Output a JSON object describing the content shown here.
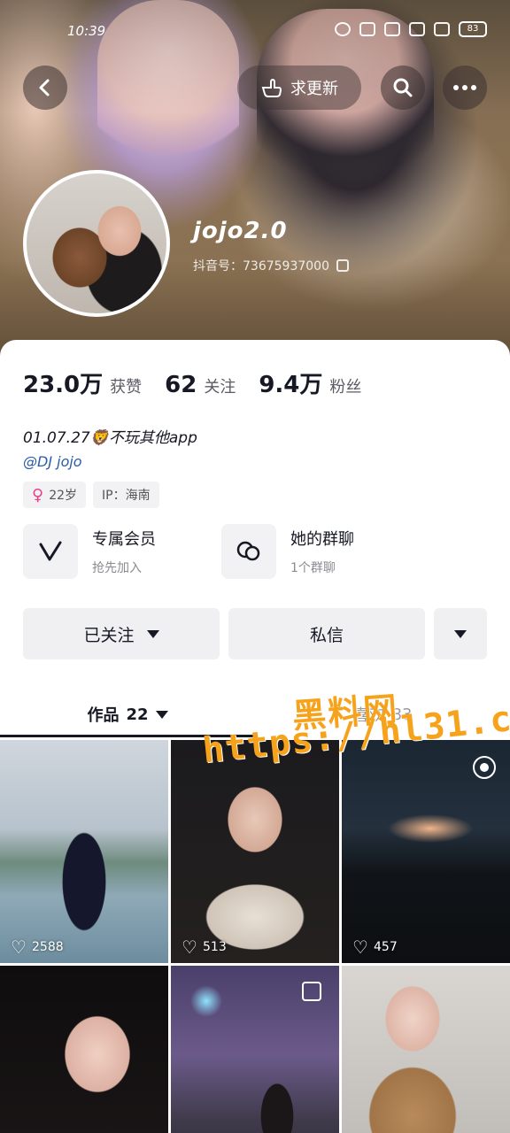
{
  "status_bar": {
    "time": "10:39",
    "battery": "83"
  },
  "header": {
    "update_label": "求更新",
    "name": "jojo2.0",
    "douyin_id": "抖音号：73675937000"
  },
  "stats": [
    {
      "num": "23.0万",
      "label": "获赞"
    },
    {
      "num": "62",
      "label": "关注"
    },
    {
      "num": "9.4万",
      "label": "粉丝"
    }
  ],
  "bio": "01.07.27🦁不玩其他app",
  "mention": "@DJ jojo",
  "tags": {
    "age": "22岁",
    "ip": "IP：海南"
  },
  "features": {
    "member_title": "专属会员",
    "member_sub": "抢先加入",
    "group_title": "她的群聊",
    "group_sub": "1个群聊"
  },
  "actions": {
    "follow": "已关注",
    "message": "私信"
  },
  "tabs": {
    "works_label": "作品",
    "works_count": "22",
    "likes_label": "喜欢",
    "likes_count": "83"
  },
  "watermark": {
    "line1": "黑料网",
    "line2": "https://hl31.co"
  },
  "grid": [
    {
      "likes": "2588"
    },
    {
      "likes": "513"
    },
    {
      "likes": "457"
    }
  ]
}
